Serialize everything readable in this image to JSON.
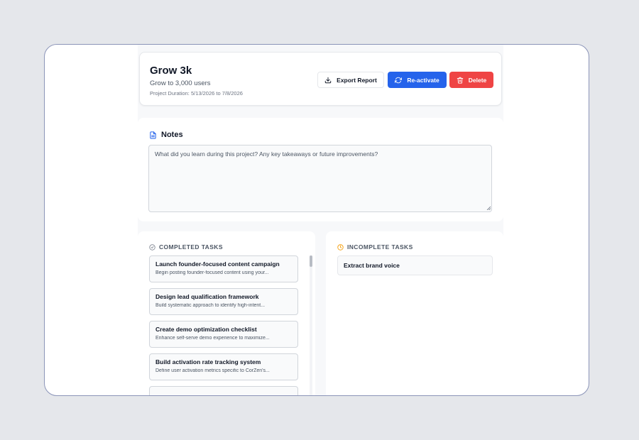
{
  "project": {
    "title": "Grow 3k",
    "subtitle": "Grow to 3,000 users",
    "duration": "Project Duration: 5/13/2026 to 7/8/2026"
  },
  "actions": {
    "export_label": "Export Report",
    "reactivate_label": "Re-activate",
    "delete_label": "Delete"
  },
  "notes": {
    "title": "Notes",
    "placeholder": "What did you learn during this project? Any key takeaways or future improvements?"
  },
  "completed": {
    "label": "COMPLETED TASKS",
    "tasks": [
      {
        "name": "Launch founder-focused content campaign",
        "desc": "Begin posting founder-focused content using your..."
      },
      {
        "name": "Design lead qualification framework",
        "desc": "Build systematic approach to identify high-intent..."
      },
      {
        "name": "Create demo optimization checklist",
        "desc": "Enhance self-serve demo experience to maximize..."
      },
      {
        "name": "Build activation rate tracking system",
        "desc": "Define user activation metrics specific to CorZen's..."
      }
    ]
  },
  "incomplete": {
    "label": "INCOMPLETE TASKS",
    "tasks": [
      {
        "name": "Extract brand voice"
      }
    ]
  },
  "icons": {
    "export": "download-icon",
    "reactivate": "refresh-icon",
    "delete": "trash-icon",
    "notes": "document-icon",
    "completed": "check-circle-icon",
    "incomplete": "clock-icon"
  },
  "colors": {
    "primary": "#2563eb",
    "danger": "#ef4444",
    "warning": "#f59e0b",
    "muted": "#6b7280"
  }
}
